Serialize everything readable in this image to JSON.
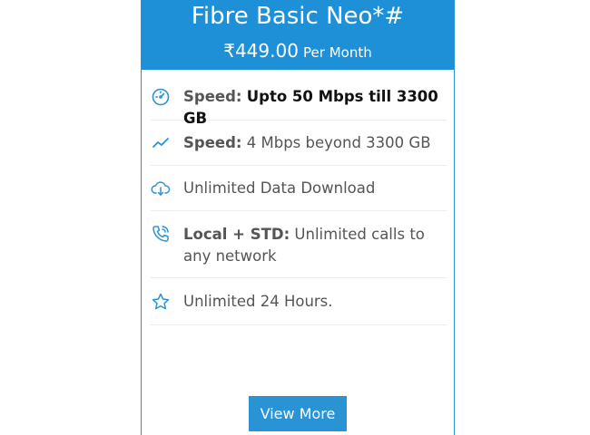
{
  "plan": {
    "title": "Fibre Basic Neo*#",
    "price": {
      "amount": "₹449.00",
      "period": "Per Month"
    }
  },
  "features": [
    {
      "icon": "speedometer-icon",
      "label": "Speed:",
      "value": "Upto 50 Mbps till 3300 GB"
    },
    {
      "icon": "trend-line-icon",
      "label": "Speed:",
      "value": "4 Mbps beyond 3300 GB"
    },
    {
      "icon": "cloud-download-icon",
      "label": "",
      "value": "Unlimited Data Download"
    },
    {
      "icon": "phone-call-icon",
      "label": "Local + STD:",
      "value": "Unlimited calls to any network"
    },
    {
      "icon": "star-icon",
      "label": "",
      "value": "Unlimited 24 Hours."
    }
  ],
  "cta": {
    "label": "View More"
  },
  "colors": {
    "header_bg": "#1e90d7",
    "accent": "#2a93d4",
    "text": "#555555"
  }
}
